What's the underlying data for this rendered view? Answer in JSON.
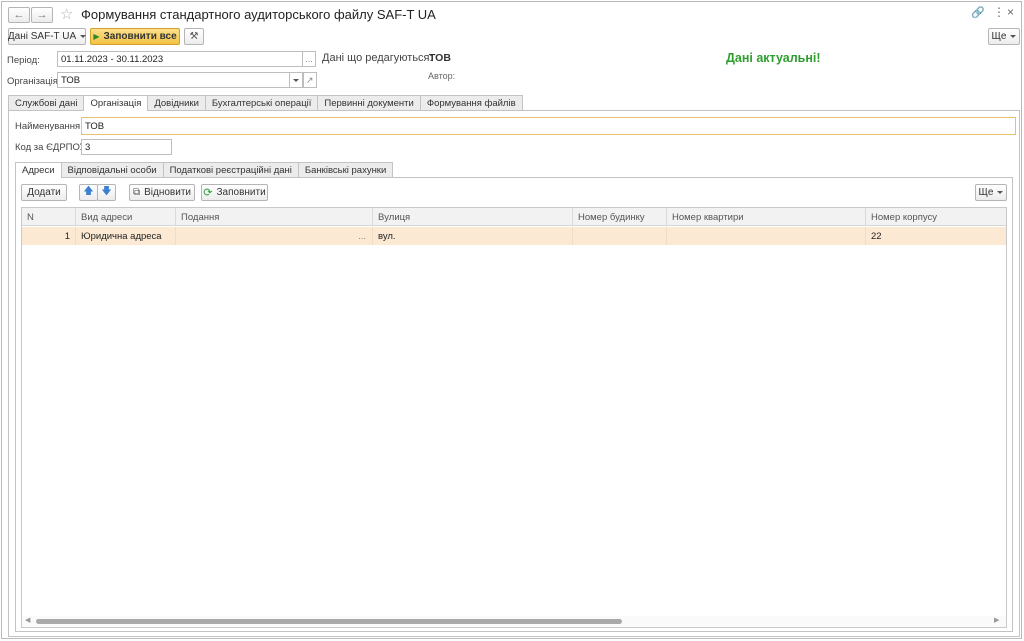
{
  "window": {
    "title": "Формування стандартного аудиторського файлу SAF-T UA"
  },
  "toolbar": {
    "data_menu_label": "Дані SAF-T UA",
    "fill_all_label": "Заповнити все",
    "more_label": "Ще"
  },
  "header": {
    "period_label": "Період:",
    "period_value": "01.11.2023 - 30.11.2023",
    "period_more": "...",
    "edited_label": "Дані що редагуються:",
    "edited_value": "ТОВ",
    "author_label": "Автор:",
    "status_text": "Дані актуальні!",
    "status_color": "#2e9e2e",
    "org_label": "Організація:",
    "org_value": "ТОВ"
  },
  "main_tabs": [
    {
      "label": "Службові дані"
    },
    {
      "label": "Організація"
    },
    {
      "label": "Довідники"
    },
    {
      "label": "Бухгалтерські операції"
    },
    {
      "label": "Первинні документи"
    },
    {
      "label": "Формування файлів"
    }
  ],
  "org": {
    "name_label": "Найменування:",
    "name_value": "ТОВ",
    "edrpou_label": "Код за ЄДРПОУ:",
    "edrpou_value": "3"
  },
  "sub_tabs": [
    {
      "label": "Адреси"
    },
    {
      "label": "Відповідальні особи"
    },
    {
      "label": "Податкові реєстраційні дані"
    },
    {
      "label": "Банківські рахунки"
    }
  ],
  "addr_toolbar": {
    "add_label": "Додати",
    "restore_label": "Відновити",
    "fill_label": "Заповнити",
    "more_label": "Ще"
  },
  "grid": {
    "columns": [
      "N",
      "Вид адреси",
      "Подання",
      "Вулиця",
      "Номер будинку",
      "Номер квартири",
      "Номер корпусу"
    ],
    "rows": [
      {
        "n": "1",
        "type": "Юридична адреса",
        "view": "",
        "view_more": "...",
        "street": "вул.",
        "house": "",
        "apt": "",
        "corp": "22"
      }
    ]
  }
}
